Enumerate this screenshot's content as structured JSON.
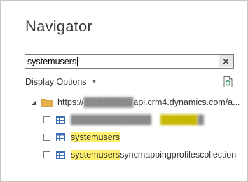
{
  "dialog": {
    "title": "Navigator"
  },
  "search": {
    "value": "systemusers",
    "clear_label": "✕"
  },
  "toolbar": {
    "display_options_label": "Display Options",
    "display_options_arrow": "▼"
  },
  "tree": {
    "root": {
      "expander": "◢",
      "url_prefix": "https://",
      "url_redacted": "                ",
      "url_suffix": "api.crm4.dynamics.com/a..."
    },
    "items": [
      {
        "checked": false,
        "text_redacted_pre": "              ",
        "highlight": "          ",
        "text_redacted_post": "  "
      },
      {
        "checked": false,
        "highlight": "systemusers",
        "rest": ""
      },
      {
        "checked": false,
        "highlight": "systemusers",
        "rest": "syncmappingprofilescollection"
      }
    ]
  },
  "colors": {
    "highlight": "#fff16d",
    "folder": "#e8b04b",
    "table_icon": "#3c6eb4",
    "refresh_accent": "#2e8b57"
  }
}
